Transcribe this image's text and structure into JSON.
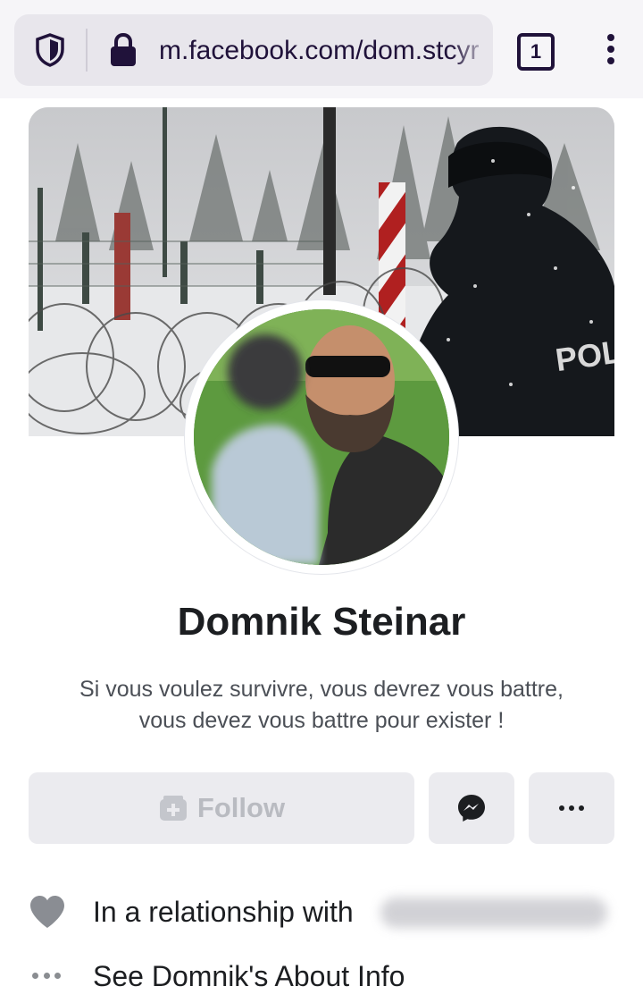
{
  "browser": {
    "url": "m.facebook.com/dom.stcyr",
    "tab_count": "1",
    "icons": {
      "privacy": "shield-icon",
      "security": "lock-icon",
      "menu": "kebab-menu-icon"
    }
  },
  "profile": {
    "name": "Domnik Steinar",
    "bio_line1": "Si vous voulez survivre, vous devrez vous battre,",
    "bio_line2": "vous devez vous battre pour exister !",
    "cover_vest_text": "POLIC"
  },
  "actions": {
    "follow_label": "Follow",
    "follow_icon": "follow-icon",
    "message_icon": "messenger-icon",
    "more_icon": "more-dots-icon"
  },
  "info": {
    "relationship_label": "In a relationship with",
    "about_label": "See Domnik's About Info"
  },
  "colors": {
    "button_bg": "#ebebef",
    "follow_disabled_text": "#b9bbc1",
    "browser_bar": "#f6f5f8",
    "browser_accent": "#20123a"
  }
}
